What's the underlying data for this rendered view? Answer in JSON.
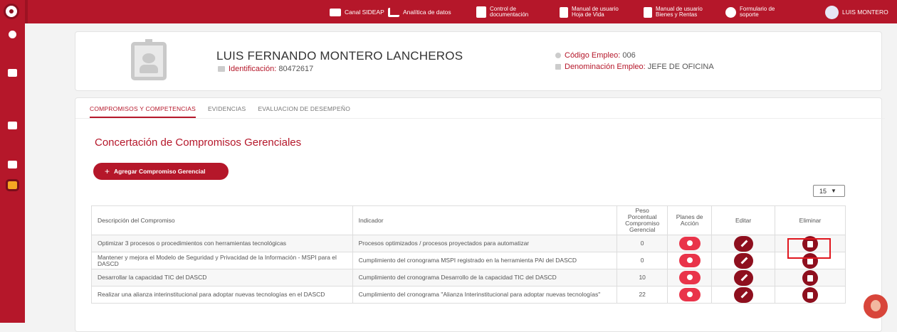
{
  "topbar": {
    "items": [
      {
        "label": "Canal SIDEAP",
        "icon": "video-icon"
      },
      {
        "label": "Analítica de datos",
        "icon": "analytics-icon"
      },
      {
        "label": "Control de\ndocumentación",
        "icon": "document-icon"
      },
      {
        "label": "Manual de usuario\nHoja de Vida",
        "icon": "file-icon"
      },
      {
        "label": "Manual de usuario\nBienes y Rentas",
        "icon": "money-file-icon"
      },
      {
        "label": "Formulario de\nsoporte",
        "icon": "help-icon"
      }
    ],
    "user": "LUIS MONTERO"
  },
  "profile": {
    "name": "LUIS FERNANDO MONTERO LANCHEROS",
    "id_label": "Identificación:",
    "id_value": "80472617",
    "code_label": "Código Empleo:",
    "code_value": "006",
    "denom_label": "Denominación Empleo:",
    "denom_value": "JEFE DE OFICINA"
  },
  "tabs": [
    {
      "label": "COMPROMISOS Y COMPETENCIAS",
      "active": true
    },
    {
      "label": "EVIDENCIAS",
      "active": false
    },
    {
      "label": "EVALUACION DE DESEMPEÑO",
      "active": false
    }
  ],
  "section": {
    "title": "Concertación de Compromisos Gerenciales",
    "add_button": "Agregar Compromiso Gerencial",
    "page_size": "15"
  },
  "table": {
    "headers": {
      "description": "Descripción del Compromiso",
      "indicator": "Indicador",
      "weight": "Peso Porcentual Compromiso Gerencial",
      "plans": "Planes de Acción",
      "edit": "Editar",
      "delete": "Eliminar"
    },
    "rows": [
      {
        "description": "Optimizar 3 procesos o procedimientos con herramientas tecnológicas",
        "indicator": "Procesos optimizados / procesos proyectados para automatizar",
        "weight": "0"
      },
      {
        "description": "Mantener y mejora el Modelo de Seguridad y Privacidad de la Información - MSPI para el DASCD",
        "indicator": "Cumplimiento del cronograma MSPI registrado en la herramienta PAI del DASCD",
        "weight": "0"
      },
      {
        "description": "Desarrollar la capacidad TIC del DASCD",
        "indicator": "Cumplimiento del cronograma Desarrollo de la capacidad TIC del DASCD",
        "weight": "10"
      },
      {
        "description": "Realizar una alianza interinstitucional para adoptar nuevas tecnologías en el DASCD",
        "indicator": "Cumplimiento del cronograma \"Alianza Interinstitucional para adoptar nuevas tecnologías\"",
        "weight": "22"
      }
    ]
  },
  "colors": {
    "brand": "#b5172a",
    "action_light": "#e9344a",
    "action_dark": "#8e0f1e",
    "highlight": "#e0161e"
  }
}
